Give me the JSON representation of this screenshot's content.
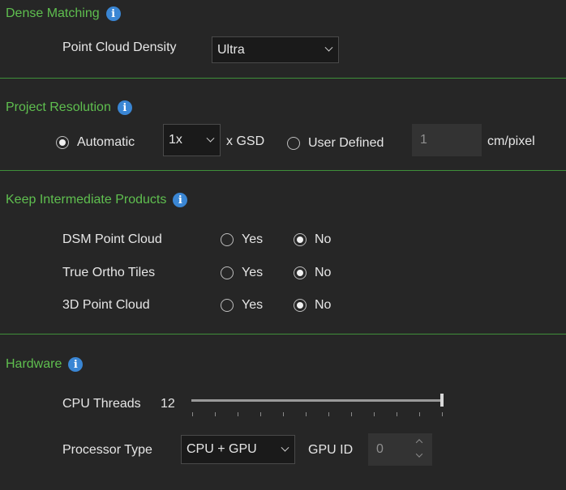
{
  "dense_matching": {
    "title": "Dense Matching",
    "point_cloud_density_label": "Point Cloud Density",
    "point_cloud_density_value": "Ultra"
  },
  "project_resolution": {
    "title": "Project Resolution",
    "automatic_label": "Automatic",
    "multiplier_value": "1x",
    "gsd_label": "x GSD",
    "user_defined_label": "User Defined",
    "user_defined_value": "1",
    "unit_label": "cm/pixel",
    "selected": "automatic"
  },
  "keep_intermediate": {
    "title": "Keep Intermediate Products",
    "yes_label": "Yes",
    "no_label": "No",
    "rows": [
      {
        "label": "DSM Point Cloud",
        "value": "No"
      },
      {
        "label": "True Ortho Tiles",
        "value": "No"
      },
      {
        "label": "3D Point Cloud",
        "value": "No"
      }
    ]
  },
  "hardware": {
    "title": "Hardware",
    "cpu_threads_label": "CPU Threads",
    "cpu_threads_value": "12",
    "processor_type_label": "Processor Type",
    "processor_type_value": "CPU + GPU",
    "gpu_id_label": "GPU ID",
    "gpu_id_value": "0"
  },
  "colors": {
    "section_title": "#5fbf4f",
    "divider": "#3f8f3a",
    "info_icon": "#3a86d4",
    "background": "#262626"
  },
  "icons": {
    "info": "info-icon",
    "dropdown": "chevron-down-icon",
    "spin_up": "chevron-up-icon",
    "spin_down": "chevron-down-icon"
  }
}
